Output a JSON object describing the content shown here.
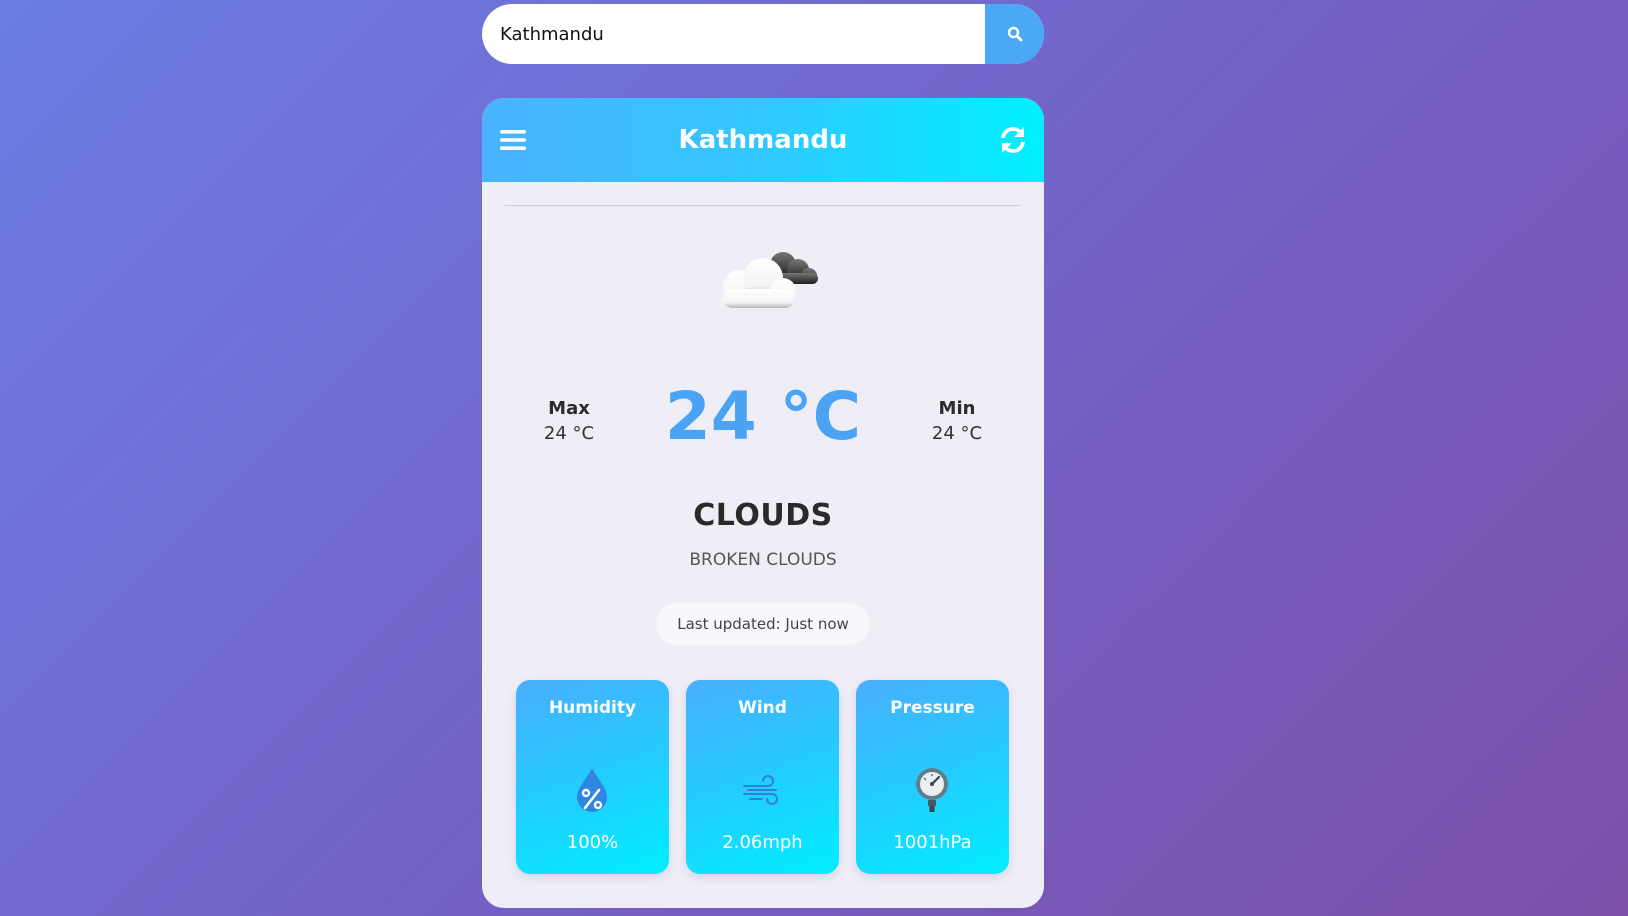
{
  "search": {
    "value": "Kathmandu",
    "icon": "search-icon"
  },
  "header": {
    "city": "Kathmandu",
    "menu_icon": "hamburger-menu-icon",
    "refresh_icon": "refresh-icon"
  },
  "weather": {
    "icon": "broken-clouds-icon",
    "max_label": "Max",
    "max_value": "24 °C",
    "current_temp": "24 °C",
    "min_label": "Min",
    "min_value": "24 °C",
    "condition": "CLOUDS",
    "description": "BROKEN CLOUDS",
    "last_updated": "Last updated: Just now"
  },
  "details": [
    {
      "title": "Humidity",
      "value": "100%",
      "icon": "humidity-drop-icon"
    },
    {
      "title": "Wind",
      "value": "2.06mph",
      "icon": "wind-icon"
    },
    {
      "title": "Pressure",
      "value": "1001hPa",
      "icon": "pressure-gauge-icon"
    }
  ],
  "colors": {
    "accent": "#4aa3f4",
    "header_gradient_start": "#4ab2ff",
    "header_gradient_end": "#00f0ff",
    "background_start": "#6b7ee3",
    "background_end": "#7b4fa8"
  }
}
